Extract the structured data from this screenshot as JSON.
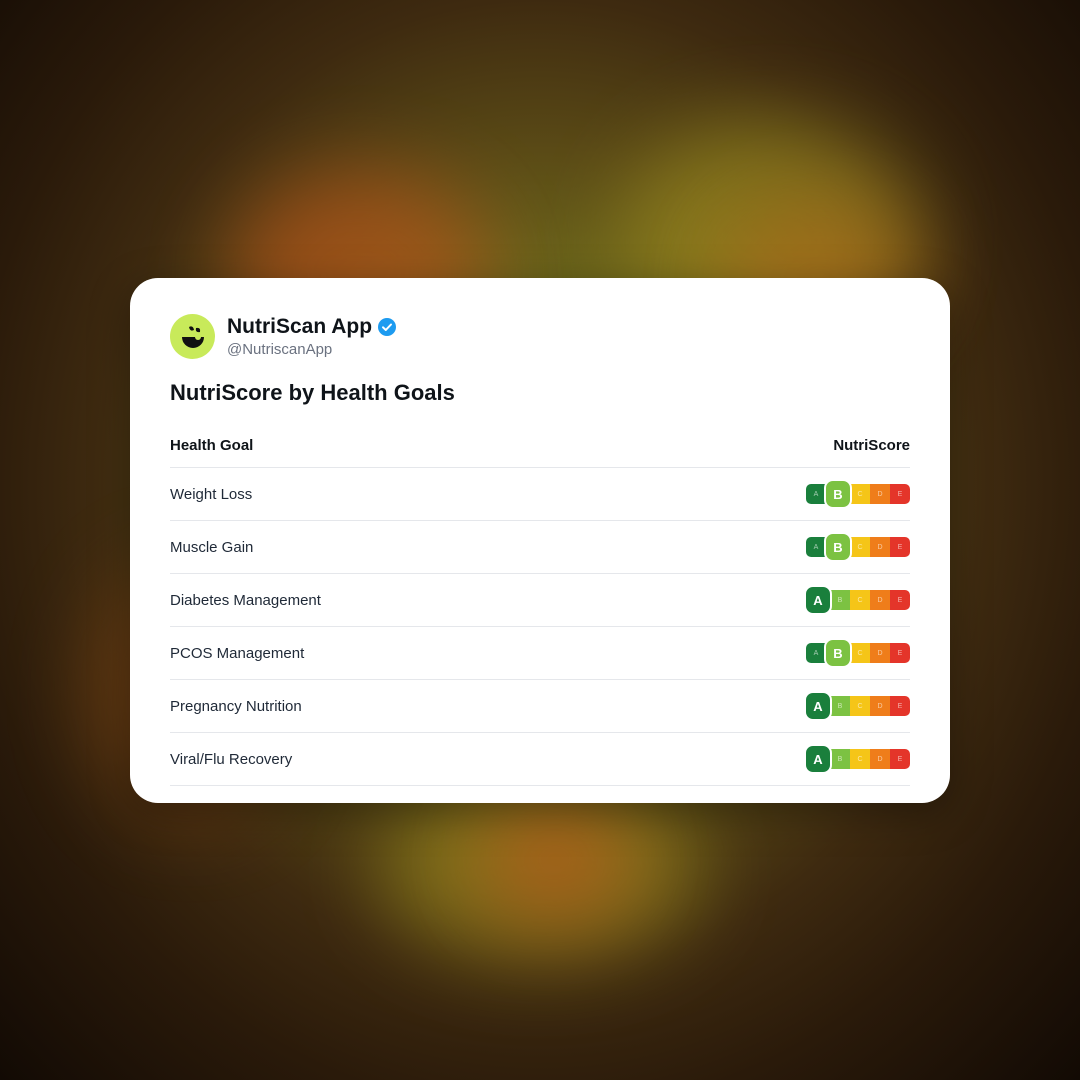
{
  "post": {
    "account_name": "NutriScan App",
    "handle": "@NutriscanApp",
    "verified": true,
    "title": "NutriScore by Health Goals",
    "avatar_icon": "leaf-smile-logo-icon"
  },
  "table": {
    "col_goal": "Health Goal",
    "col_score": "NutriScore",
    "rows": [
      {
        "goal": "Weight Loss",
        "score": "B"
      },
      {
        "goal": "Muscle Gain",
        "score": "B"
      },
      {
        "goal": "Diabetes Management",
        "score": "A"
      },
      {
        "goal": "PCOS Management",
        "score": "B"
      },
      {
        "goal": "Pregnancy Nutrition",
        "score": "A"
      },
      {
        "goal": "Viral/Flu Recovery",
        "score": "A"
      }
    ]
  },
  "nutriscore_scale": {
    "letters": [
      "A",
      "B",
      "C",
      "D",
      "E"
    ],
    "colors": {
      "A": "#1a7f3c",
      "B": "#7cc242",
      "C": "#f5c518",
      "D": "#ef7d1a",
      "E": "#e4352a"
    }
  },
  "colors": {
    "avatar_bg": "#c8ea5a",
    "verified_badge": "#1d9bf0",
    "card_bg": "#ffffff"
  }
}
